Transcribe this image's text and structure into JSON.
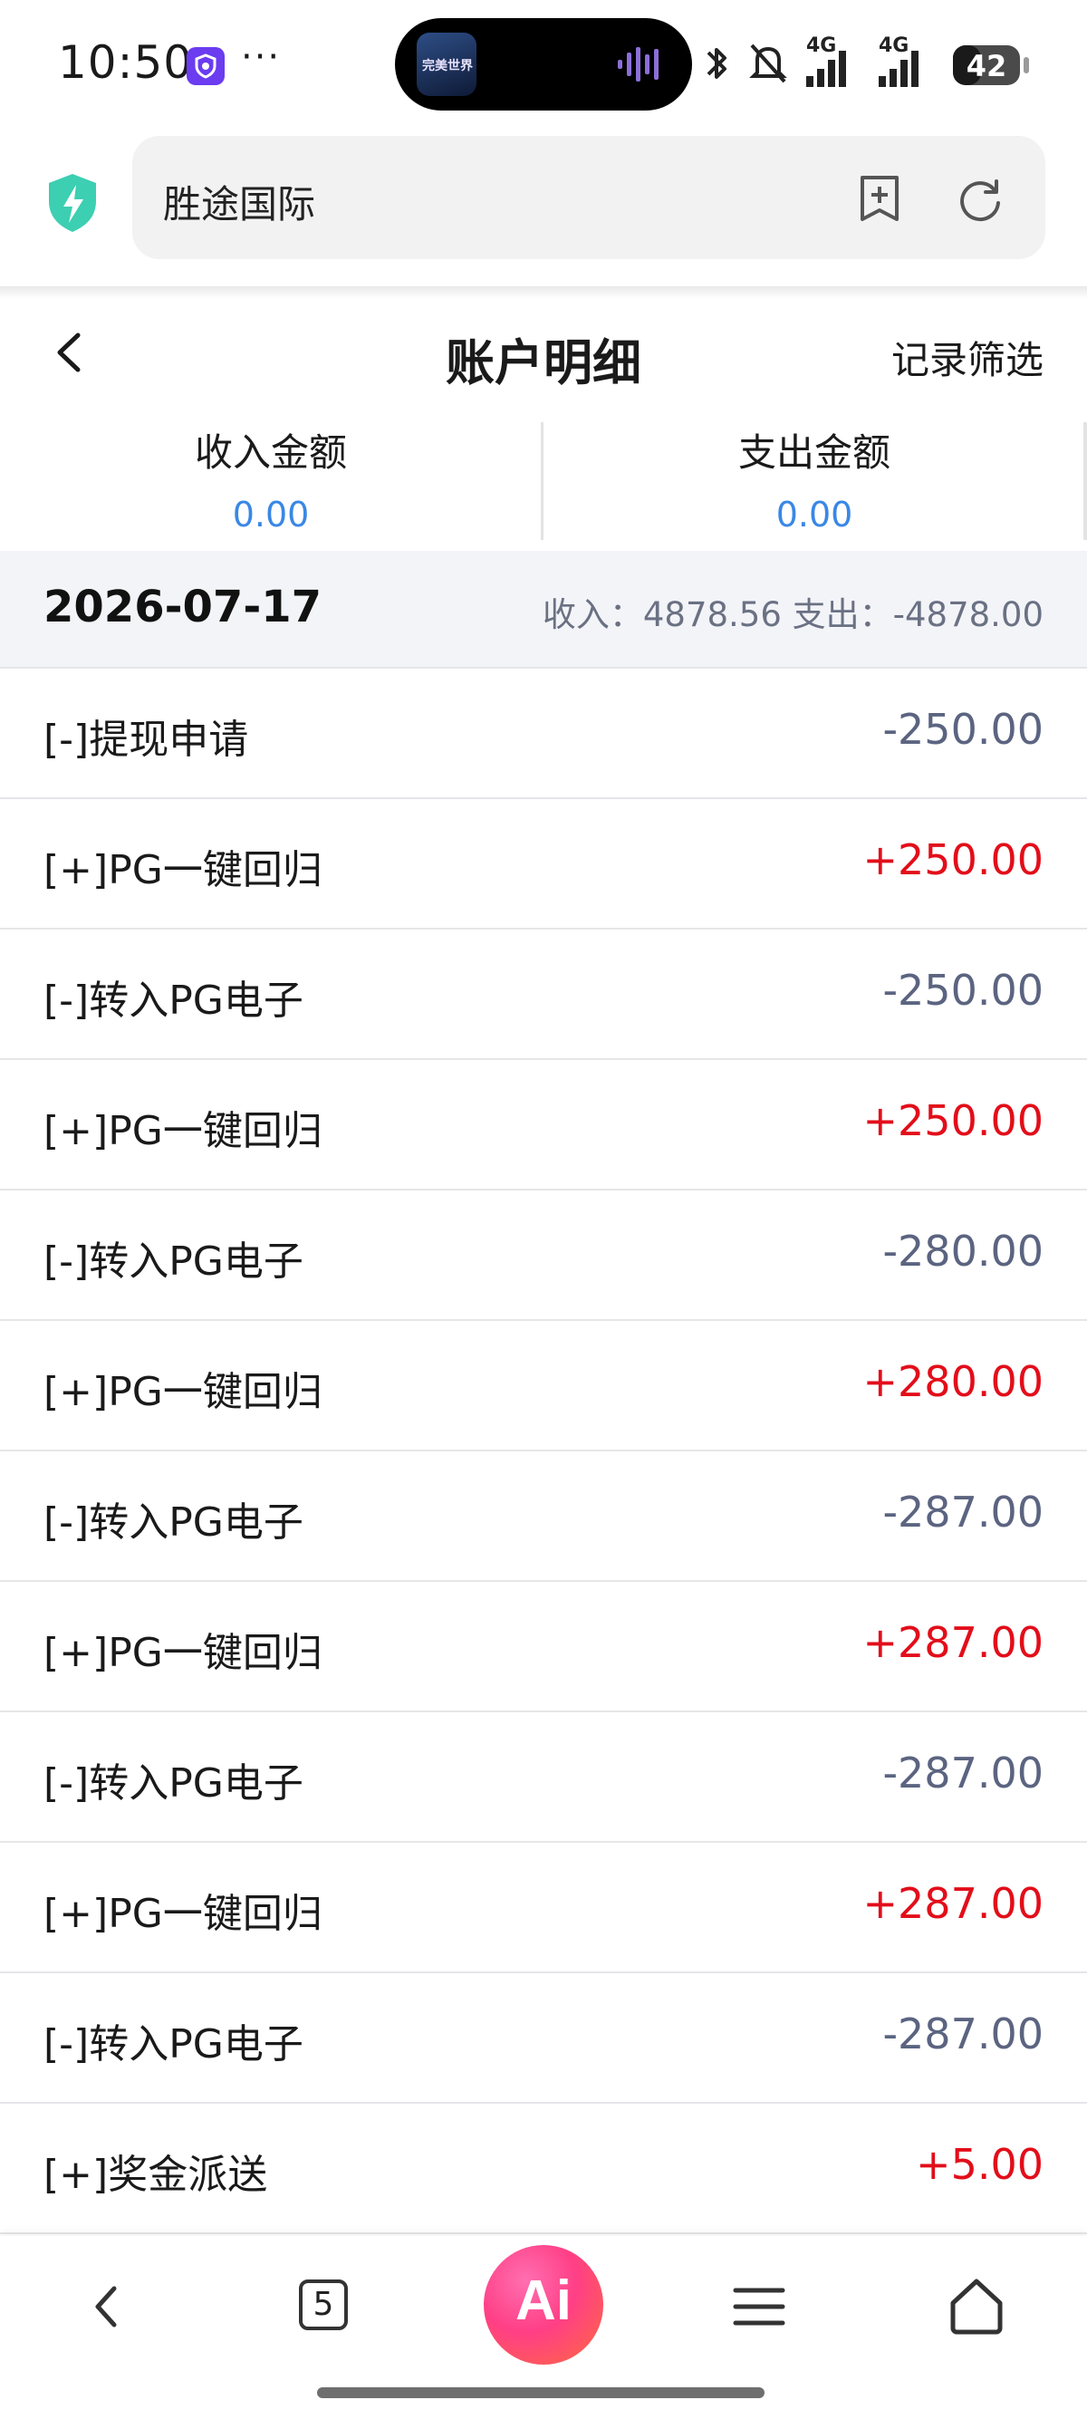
{
  "status_bar": {
    "time": "10:50",
    "dots": "···",
    "network_1": "4G",
    "network_2": "4G",
    "battery_percent": 42,
    "battery": "42",
    "island_thumb_text": "完美世界"
  },
  "browser": {
    "address_text": "胜途国际"
  },
  "header": {
    "title": "账户明细",
    "filter_label": "记录筛选"
  },
  "summary": {
    "income_label": "收入金额",
    "income_value": "0.00",
    "expense_label": "支出金额",
    "expense_value": "0.00"
  },
  "date_group": {
    "date": "2026-07-17",
    "totals": "收入：4878.56  支出：-4878.00"
  },
  "transactions": [
    {
      "label": "[-]提现申请",
      "amount": "-250.00",
      "type": "out"
    },
    {
      "label": "[+]PG一键回归",
      "amount": "+250.00",
      "type": "in"
    },
    {
      "label": "[-]转入PG电子",
      "amount": "-250.00",
      "type": "out"
    },
    {
      "label": "[+]PG一键回归",
      "amount": "+250.00",
      "type": "in"
    },
    {
      "label": "[-]转入PG电子",
      "amount": "-280.00",
      "type": "out"
    },
    {
      "label": "[+]PG一键回归",
      "amount": "+280.00",
      "type": "in"
    },
    {
      "label": "[-]转入PG电子",
      "amount": "-287.00",
      "type": "out"
    },
    {
      "label": "[+]PG一键回归",
      "amount": "+287.00",
      "type": "in"
    },
    {
      "label": "[-]转入PG电子",
      "amount": "-287.00",
      "type": "out"
    },
    {
      "label": "[+]PG一键回归",
      "amount": "+287.00",
      "type": "in"
    },
    {
      "label": "[-]转入PG电子",
      "amount": "-287.00",
      "type": "out"
    },
    {
      "label": "[+]奖金派送",
      "amount": "+5.00",
      "type": "in"
    }
  ],
  "bottom_nav": {
    "tab_count": "5",
    "ai_label": "Ai"
  },
  "colors": {
    "income_red": "#e20e1a",
    "expense_gray": "#5b6480",
    "summary_blue": "#3a87e6",
    "date_bar_bg": "#f3f4f8"
  },
  "icons": [
    "vpn-icon",
    "bluetooth-icon",
    "mute-icon",
    "signal-icon",
    "battery-icon",
    "shield-icon",
    "add-bookmark-icon",
    "refresh-icon",
    "back-icon",
    "tabs-icon",
    "ai-icon",
    "menu-icon",
    "home-icon"
  ]
}
